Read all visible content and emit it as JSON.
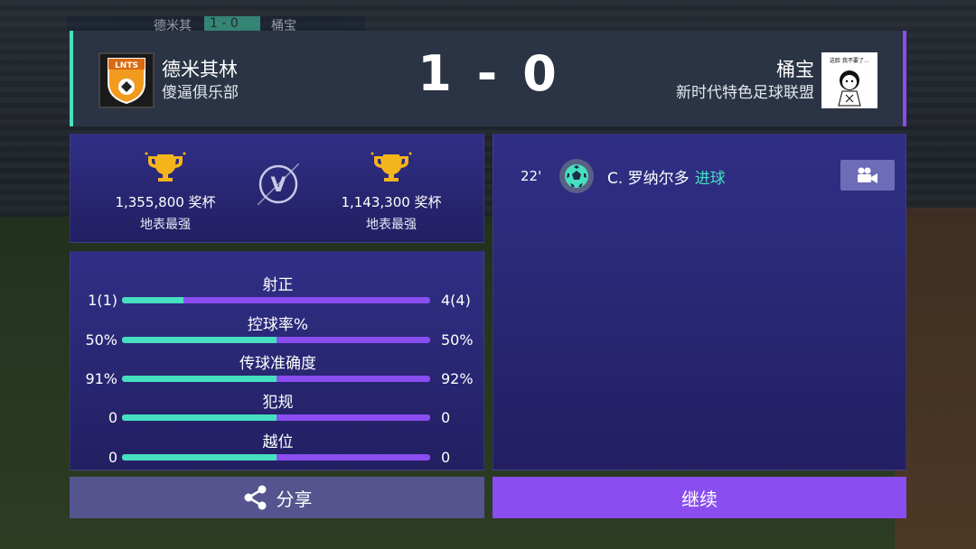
{
  "background": {
    "top_bar": {
      "home_short": "德米其",
      "score": "1 - 0",
      "away_short": "桶宝"
    }
  },
  "header": {
    "home": {
      "team_name": "德米其林",
      "club_name": "傻逼俱乐部",
      "crest_text": "LNTS"
    },
    "away": {
      "team_name": "桶宝",
      "club_name": "新时代特色足球联盟",
      "avatar_text": "这脸 我不要了…"
    },
    "score": {
      "home": "1",
      "separator": "-",
      "away": "0"
    },
    "colors": {
      "home_accent": "#45e0bf",
      "away_accent": "#8a4df0"
    }
  },
  "trophies": {
    "home": {
      "count": "1,355,800 奖杯",
      "rank": "地表最强"
    },
    "away": {
      "count": "1,143,300 奖杯",
      "rank": "地表最强"
    },
    "vs": "V"
  },
  "stats": [
    {
      "label": "射正",
      "home": "1(1)",
      "away": "4(4)",
      "home_share": 0.2
    },
    {
      "label": "控球率%",
      "home": "50%",
      "away": "50%",
      "home_share": 0.5
    },
    {
      "label": "传球准确度",
      "home": "91%",
      "away": "92%",
      "home_share": 0.5
    },
    {
      "label": "犯规",
      "home": "0",
      "away": "0",
      "home_share": 0.5
    },
    {
      "label": "越位",
      "home": "0",
      "away": "0",
      "home_share": 0.5
    }
  ],
  "events": [
    {
      "minute": "22'",
      "icon": "soccer-ball-icon",
      "player": "C. 罗纳尔多",
      "action": "进球"
    }
  ],
  "buttons": {
    "share": "分享",
    "continue": "继续",
    "replay_icon": "video-camera-icon"
  }
}
